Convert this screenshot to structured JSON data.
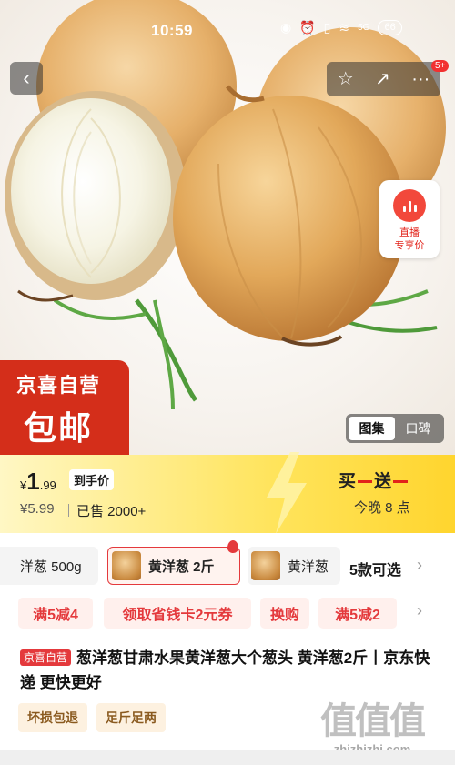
{
  "status_bar": {
    "time": "10:59",
    "network": "5G",
    "battery": "66"
  },
  "nav": {
    "back_icon": "‹",
    "favorite_icon": "☆",
    "share_icon": "↗",
    "more_icon": "···",
    "message_badge": "5+"
  },
  "live": {
    "line1": "直播",
    "line2": "专享价"
  },
  "brand_badge": {
    "line1": "京喜自营",
    "line2": "包邮"
  },
  "gallery_switch": {
    "images": "图集",
    "reviews": "口碑"
  },
  "price": {
    "currency": "¥",
    "integer": "1",
    "decimal": ".99",
    "tag": "到手价",
    "original": "¥5.99",
    "sold": "已售 2000+"
  },
  "promo": {
    "part1": "买",
    "part2": "送",
    "subtitle": "今晚 8 点"
  },
  "specs": {
    "items": [
      {
        "label": "洋葱 500g",
        "selected": false
      },
      {
        "label": "黄洋葱 2斤",
        "selected": true
      },
      {
        "label": "黄洋葱",
        "selected": false
      }
    ],
    "more": "5款可选"
  },
  "coupons": [
    "满5减4",
    "领取省钱卡2元券",
    "换购",
    "满5减2"
  ],
  "product": {
    "tag": "京喜自营",
    "title": "葱洋葱甘肃水果黄洋葱大个葱头 黄洋葱2斤丨京东快递 更快更好"
  },
  "services": [
    "坏损包退",
    "足斤足两"
  ],
  "watermark": {
    "big": "值值值",
    "small": "zhizhizhi.com"
  },
  "colors": {
    "accent": "#e4393c",
    "brand_red": "#d42e1a",
    "promo_yellow": "#ffe45c"
  }
}
